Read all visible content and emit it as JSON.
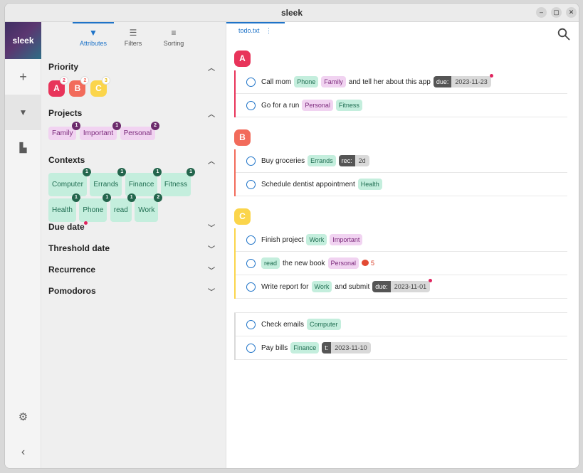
{
  "window": {
    "title": "sleek",
    "controls": [
      "–",
      "▢",
      "✕"
    ]
  },
  "rail": {
    "logo": "sleek",
    "buttons": [
      {
        "name": "add-todo-button",
        "icon": "+"
      },
      {
        "name": "filter-drawer-button",
        "icon": "▼"
      },
      {
        "name": "archive-button",
        "icon": "▙"
      }
    ],
    "settings_icon": "⚙",
    "collapse_icon": "‹"
  },
  "drawer": {
    "tabs": [
      {
        "label": "Attributes",
        "icon": "▼"
      },
      {
        "label": "Filters",
        "icon": "☰"
      },
      {
        "label": "Sorting",
        "icon": "≡"
      }
    ],
    "priority": {
      "title": "Priority",
      "items": [
        {
          "label": "A",
          "count": "2",
          "color": "#e8345a"
        },
        {
          "label": "B",
          "count": "2",
          "color": "#f26b5b"
        },
        {
          "label": "C",
          "count": "3",
          "color": "#fbd54b"
        }
      ]
    },
    "projects": {
      "title": "Projects",
      "items": [
        {
          "label": "Family",
          "count": "1"
        },
        {
          "label": "Important",
          "count": "1"
        },
        {
          "label": "Personal",
          "count": "2"
        }
      ]
    },
    "contexts": {
      "title": "Contexts",
      "items": [
        {
          "label": "Computer",
          "count": "1"
        },
        {
          "label": "Errands",
          "count": "1"
        },
        {
          "label": "Finance",
          "count": "1"
        },
        {
          "label": "Fitness",
          "count": "1"
        },
        {
          "label": "Health",
          "count": "1"
        },
        {
          "label": "Phone",
          "count": "1"
        },
        {
          "label": "read",
          "count": "1"
        },
        {
          "label": "Work",
          "count": "2"
        }
      ]
    },
    "collapsed": [
      "Due date",
      "Threshold date",
      "Recurrence",
      "Pomodoros"
    ]
  },
  "main": {
    "file_tab": "todo.txt",
    "file_menu_icon": "⋮",
    "groups": [
      {
        "label": "A",
        "color": "#e8345a",
        "rows": [
          {
            "parts": [
              {
                "type": "text",
                "value": "Call mom"
              },
              {
                "type": "ctx",
                "value": "Phone"
              },
              {
                "type": "proj",
                "value": "Family"
              },
              {
                "type": "text",
                "value": "and tell her about this app"
              },
              {
                "type": "kv",
                "key": "due:",
                "value": "2023-11-23",
                "dot": true
              }
            ]
          },
          {
            "parts": [
              {
                "type": "text",
                "value": "Go for a run"
              },
              {
                "type": "proj",
                "value": "Personal"
              },
              {
                "type": "ctx",
                "value": "Fitness"
              }
            ]
          }
        ]
      },
      {
        "label": "B",
        "color": "#f26b5b",
        "rows": [
          {
            "parts": [
              {
                "type": "text",
                "value": "Buy groceries"
              },
              {
                "type": "ctx",
                "value": "Errands"
              },
              {
                "type": "kv",
                "key": "rec:",
                "value": "2d"
              }
            ]
          },
          {
            "parts": [
              {
                "type": "text",
                "value": "Schedule dentist appointment"
              },
              {
                "type": "ctx",
                "value": "Health"
              }
            ]
          }
        ]
      },
      {
        "label": "C",
        "color": "#fbd54b",
        "rows": [
          {
            "parts": [
              {
                "type": "text",
                "value": "Finish project"
              },
              {
                "type": "ctx",
                "value": "Work"
              },
              {
                "type": "proj",
                "value": "Important"
              }
            ]
          },
          {
            "parts": [
              {
                "type": "ctx",
                "value": "read"
              },
              {
                "type": "text",
                "value": "the new book"
              },
              {
                "type": "proj",
                "value": "Personal"
              },
              {
                "type": "pomo",
                "value": "5"
              }
            ]
          },
          {
            "parts": [
              {
                "type": "text",
                "value": "Write report for"
              },
              {
                "type": "ctx",
                "value": "Work"
              },
              {
                "type": "text",
                "value": "and submit"
              },
              {
                "type": "kv",
                "key": "due:",
                "value": "2023-11-01",
                "dot": true
              }
            ]
          }
        ]
      },
      {
        "label": "",
        "color": "#d9d9d9",
        "rows": [
          {
            "parts": [
              {
                "type": "text",
                "value": "Check emails"
              },
              {
                "type": "ctx",
                "value": "Computer"
              }
            ]
          },
          {
            "parts": [
              {
                "type": "text",
                "value": "Pay bills"
              },
              {
                "type": "ctx",
                "value": "Finance"
              },
              {
                "type": "kv",
                "key": "t:",
                "value": "2023-11-10"
              }
            ]
          }
        ]
      }
    ]
  }
}
